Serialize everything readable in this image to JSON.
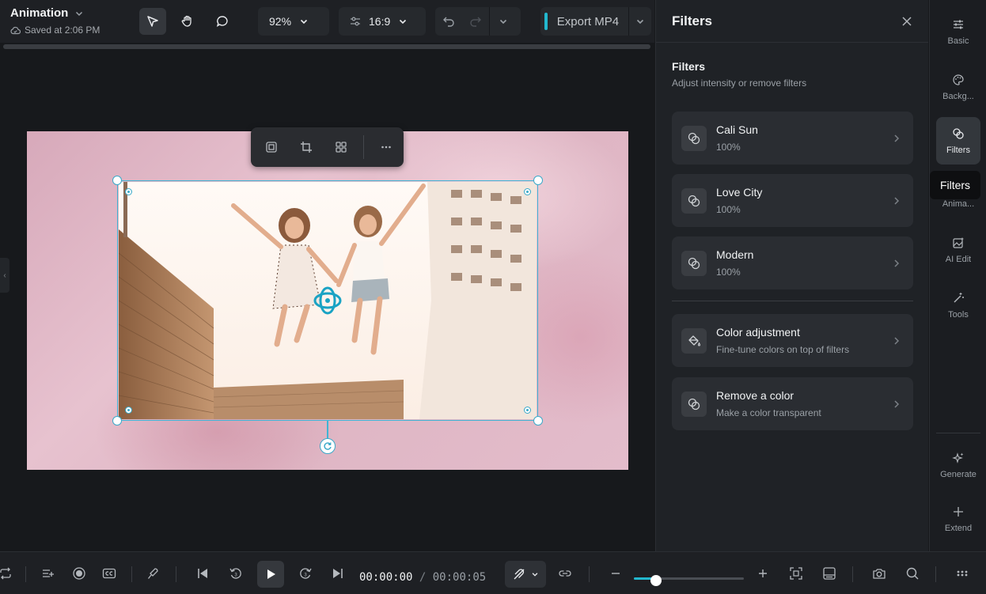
{
  "project": {
    "title": "Animation",
    "saved": "Saved at 2:06 PM"
  },
  "toolbar": {
    "zoom": "92%",
    "aspect": "16:9",
    "export_label": "Export MP4"
  },
  "panel": {
    "header": "Filters",
    "section_title": "Filters",
    "section_subtitle": "Adjust intensity or remove filters",
    "filters": [
      {
        "name": "Cali Sun",
        "value": "100%"
      },
      {
        "name": "Love City",
        "value": "100%"
      },
      {
        "name": "Modern",
        "value": "100%"
      }
    ],
    "extras": [
      {
        "title": "Color adjustment",
        "subtitle": "Fine-tune colors on top of filters"
      },
      {
        "title": "Remove a color",
        "subtitle": "Make a color transparent"
      }
    ]
  },
  "rail": {
    "items": [
      "Basic",
      "Backg...",
      "Filters",
      "Anima...",
      "AI Edit",
      "Tools"
    ],
    "bottom": [
      "Generate",
      "Extend"
    ],
    "active": "Filters",
    "tooltip": "Filters"
  },
  "playback": {
    "current": "00:00:00",
    "separator": "/",
    "duration": "00:00:05"
  },
  "zoom_slider": {
    "level": 0.2
  },
  "colors": {
    "accent": "#22b8cf",
    "selection": "#40b4d4",
    "panel": "#1f2226"
  }
}
